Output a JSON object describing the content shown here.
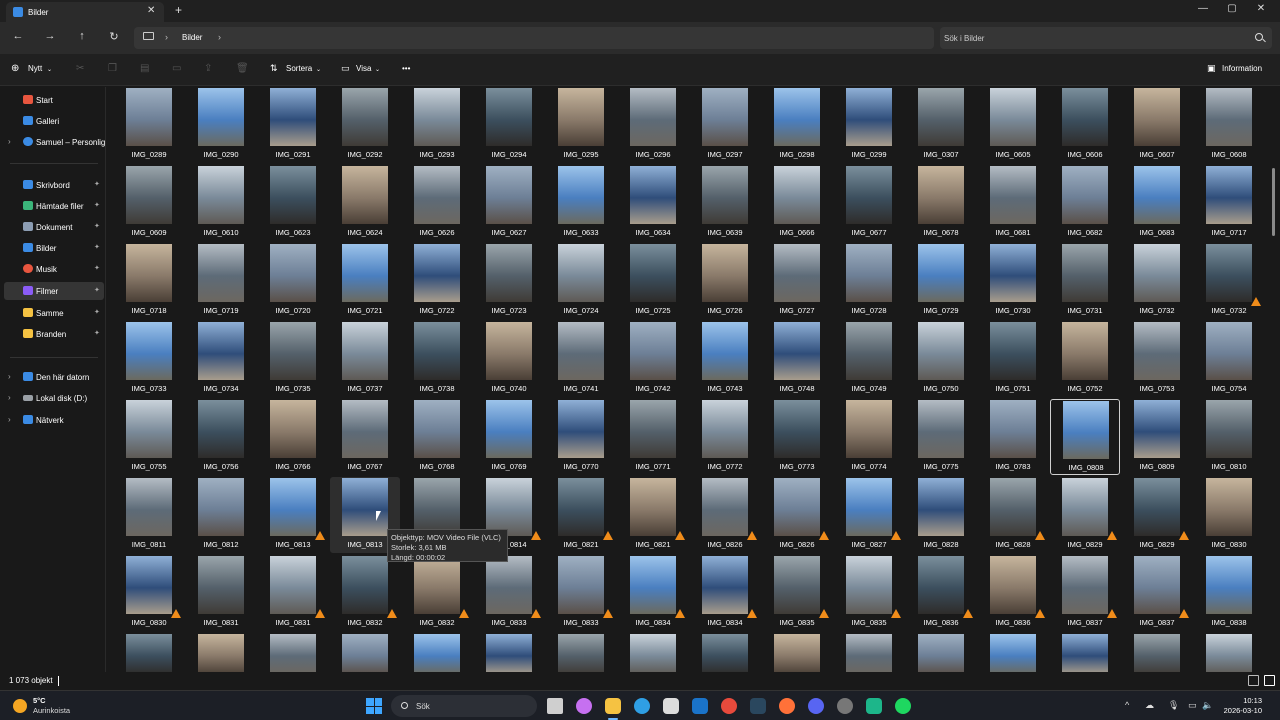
{
  "window": {
    "tab_title": "Bilder",
    "new_tab": "+",
    "minimize": "—",
    "maximize": "▢",
    "close": "✕"
  },
  "nav": {
    "back": "←",
    "forward": "→",
    "up": "↑",
    "refresh": "↻",
    "breadcrumb": "Bilder",
    "search_placeholder": "Sök i Bilder"
  },
  "toolbar": {
    "new_label": "Nytt",
    "sort_label": "Sortera",
    "view_label": "Visa",
    "more": "•••",
    "info_label": "Information"
  },
  "sidebar": {
    "items": [
      {
        "label": "Start",
        "color": "#e8563f"
      },
      {
        "label": "Galleri",
        "color": "#3b8be4"
      },
      {
        "label": "Samuel – Personlig",
        "color": "#3b8be4"
      },
      {
        "label": "Skrivbord",
        "color": "#3b8be4"
      },
      {
        "label": "Hämtade filer",
        "color": "#3bb57a"
      },
      {
        "label": "Dokument",
        "color": "#8c9db3"
      },
      {
        "label": "Bilder",
        "color": "#3b8be4"
      },
      {
        "label": "Musik",
        "color": "#e8563f"
      },
      {
        "label": "Filmer",
        "color": "#8b5cf6"
      },
      {
        "label": "Samme",
        "color": "#f5c242"
      },
      {
        "label": "Branden",
        "color": "#f5c242"
      },
      {
        "label": "Den här datorn",
        "color": "#3b8be4"
      },
      {
        "label": "Lokal disk (D:)",
        "color": "#9aa0a6"
      },
      {
        "label": "Nätverk",
        "color": "#3b8be4"
      }
    ]
  },
  "files": [
    [
      "IMG_0289",
      "IMG_0290",
      "IMG_0291",
      "IMG_0292",
      "IMG_0293",
      "IMG_0294",
      "IMG_0295",
      "IMG_0296",
      "IMG_0297",
      "IMG_0298",
      "IMG_0299",
      "IMG_0307",
      "IMG_0605",
      "IMG_0606",
      "IMG_0607",
      "IMG_0608"
    ],
    [
      "IMG_0609",
      "IMG_0610",
      "IMG_0623",
      "IMG_0624",
      "IMG_0626",
      "IMG_0627",
      "IMG_0633",
      "IMG_0634",
      "IMG_0639",
      "IMG_0666",
      "IMG_0677",
      "IMG_0678",
      "IMG_0681",
      "IMG_0682",
      "IMG_0683",
      "IMG_0717"
    ],
    [
      "IMG_0718",
      "IMG_0719",
      "IMG_0720",
      "IMG_0721",
      "IMG_0722",
      "IMG_0723",
      "IMG_0724",
      "IMG_0725",
      "IMG_0726",
      "IMG_0727",
      "IMG_0728",
      "IMG_0729",
      "IMG_0730",
      "IMG_0731",
      "IMG_0732",
      "IMG_0732"
    ],
    [
      "IMG_0733",
      "IMG_0734",
      "IMG_0735",
      "IMG_0737",
      "IMG_0738",
      "IMG_0740",
      "IMG_0741",
      "IMG_0742",
      "IMG_0743",
      "IMG_0748",
      "IMG_0749",
      "IMG_0750",
      "IMG_0751",
      "IMG_0752",
      "IMG_0753",
      "IMG_0754"
    ],
    [
      "IMG_0755",
      "IMG_0756",
      "IMG_0766",
      "IMG_0767",
      "IMG_0768",
      "IMG_0769",
      "IMG_0770",
      "IMG_0771",
      "IMG_0772",
      "IMG_0773",
      "IMG_0774",
      "IMG_0775",
      "IMG_0783",
      "IMG_0808",
      "IMG_0809",
      "IMG_0810"
    ],
    [
      "IMG_0811",
      "IMG_0812",
      "IMG_0813",
      "IMG_0813",
      "IMG_0814",
      "IMG_0814",
      "IMG_0821",
      "IMG_0821",
      "IMG_0826",
      "IMG_0826",
      "IMG_0827",
      "IMG_0828",
      "IMG_0828",
      "IMG_0829",
      "IMG_0829",
      "IMG_0830"
    ],
    [
      "IMG_0830",
      "IMG_0831",
      "IMG_0831",
      "IMG_0832",
      "IMG_0832",
      "IMG_0833",
      "IMG_0833",
      "IMG_0834",
      "IMG_0834",
      "IMG_0835",
      "IMG_0835",
      "IMG_0836",
      "IMG_0836",
      "IMG_0837",
      "IMG_0837",
      "IMG_0838"
    ],
    [
      "",
      "",
      "",
      "",
      "",
      "",
      "",
      "",
      "",
      "",
      "",
      "",
      "",
      "",
      "",
      ""
    ]
  ],
  "tooltip": {
    "line1": "Objekttyp: MOV Video File (VLC)",
    "line2": "Storlek: 3,61 MB",
    "line3": "Längd: 00:00:02"
  },
  "status": {
    "count": "1 073 objekt"
  },
  "taskbar": {
    "temp": "5°C",
    "weather": "Aurinkoista",
    "search": "Sök",
    "time": "10:13",
    "date": "2026-03-10"
  }
}
